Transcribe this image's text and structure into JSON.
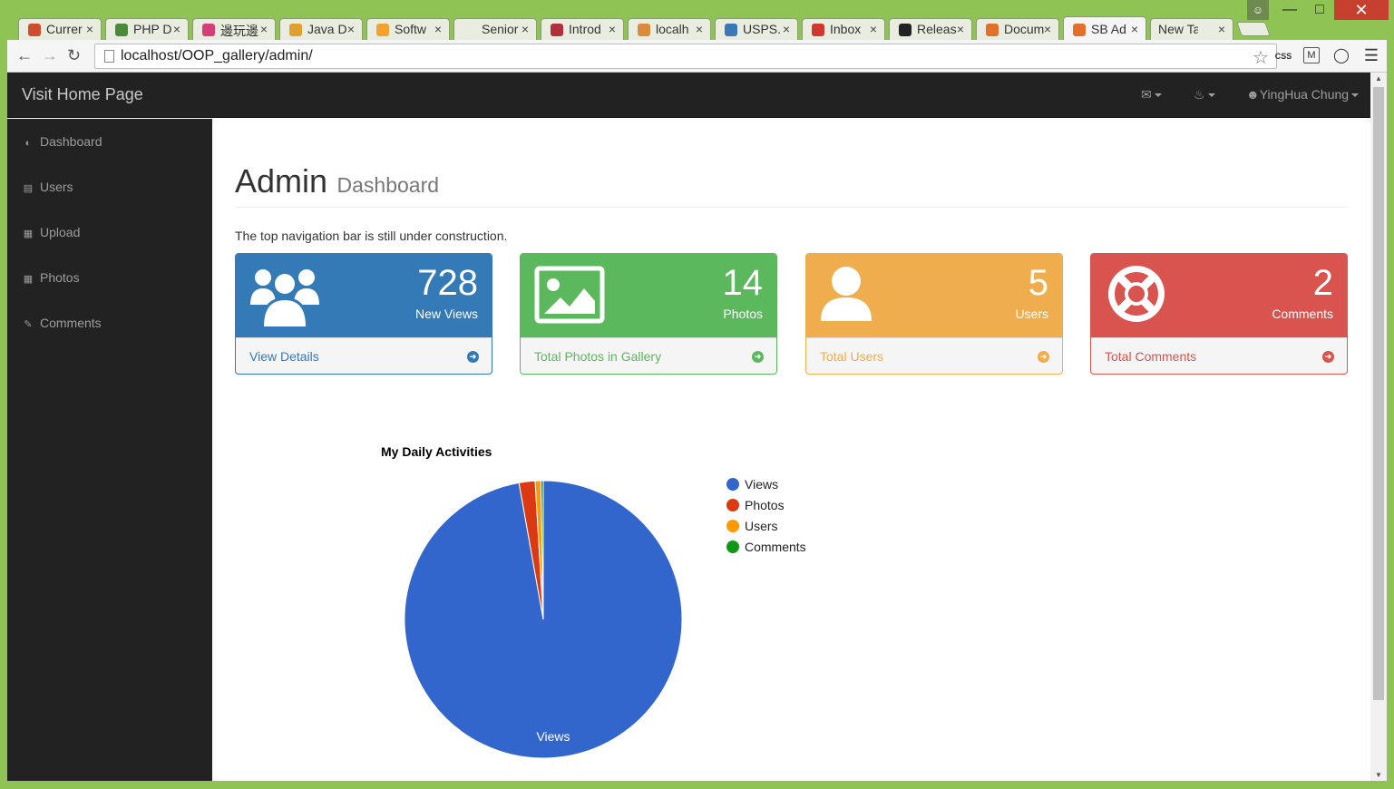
{
  "browser": {
    "tabs": [
      {
        "title": "Currer",
        "icon_color": "#d04c2f",
        "icon": "flag-icon"
      },
      {
        "title": "PHP D",
        "icon_color": "#4a8a3a",
        "icon": "chrome-icon"
      },
      {
        "title": "邊玩邊",
        "icon_color": "#d43f78",
        "icon": "heart-icon"
      },
      {
        "title": "Java D",
        "icon_color": "#e0a030",
        "icon": "pen-icon"
      },
      {
        "title": "Softw",
        "icon_color": "#f2a22e",
        "icon": "wifi-icon"
      },
      {
        "title": "Senior",
        "icon_color": "#e9eddf",
        "icon": "blank-icon"
      },
      {
        "title": "Introd",
        "icon_color": "#b03040",
        "icon": "raspberry-icon"
      },
      {
        "title": "localh",
        "icon_color": "#d98a3a",
        "icon": "pma-icon"
      },
      {
        "title": "USPS.",
        "icon_color": "#3a78b8",
        "icon": "usps-icon"
      },
      {
        "title": "Inbox",
        "icon_color": "#d0382c",
        "icon": "gmail-icon"
      },
      {
        "title": "Releas",
        "icon_color": "#222222",
        "icon": "github-icon"
      },
      {
        "title": "Docum",
        "icon_color": "#e0702a",
        "icon": "doc-icon"
      },
      {
        "title": "SB Ad",
        "icon_color": "#e0702a",
        "icon": "sb-icon"
      },
      {
        "title": "New Tab",
        "icon_color": "",
        "icon": ""
      }
    ],
    "url": "localhost/OOP_gallery/admin/"
  },
  "topnav": {
    "brand": "Visit Home Page",
    "user": "YingHua Chung"
  },
  "sidebar": {
    "items": [
      {
        "label": "Dashboard",
        "icon": "dashboard-icon"
      },
      {
        "label": "Users",
        "icon": "bar-chart-icon"
      },
      {
        "label": "Upload",
        "icon": "table-icon"
      },
      {
        "label": "Photos",
        "icon": "table-icon"
      },
      {
        "label": "Comments",
        "icon": "edit-icon"
      }
    ]
  },
  "header": {
    "title": "Admin",
    "subtitle": "Dashboard"
  },
  "notice": "The top navigation bar is still under construction.",
  "panels": [
    {
      "value": "728",
      "label": "New Views",
      "footer": "View Details",
      "color": "#337ab7",
      "icon": "users-icon"
    },
    {
      "value": "14",
      "label": "Photos",
      "footer": "Total Photos in Gallery",
      "color": "#5cb85c",
      "icon": "picture-icon"
    },
    {
      "value": "5",
      "label": "Users",
      "footer": "Total Users",
      "color": "#f0ad4e",
      "icon": "user-icon"
    },
    {
      "value": "2",
      "label": "Comments",
      "footer": "Total Comments",
      "color": "#d9534f",
      "icon": "life-ring-icon"
    }
  ],
  "chart_data": {
    "type": "pie",
    "title": "My Daily Activities",
    "categories": [
      "Views",
      "Photos",
      "Users",
      "Comments"
    ],
    "values": [
      728,
      14,
      5,
      2
    ],
    "colors": [
      "#3366cc",
      "#dc3912",
      "#ff9900",
      "#109618"
    ],
    "slice_labels": [
      "Views"
    ],
    "legend_position": "right"
  }
}
